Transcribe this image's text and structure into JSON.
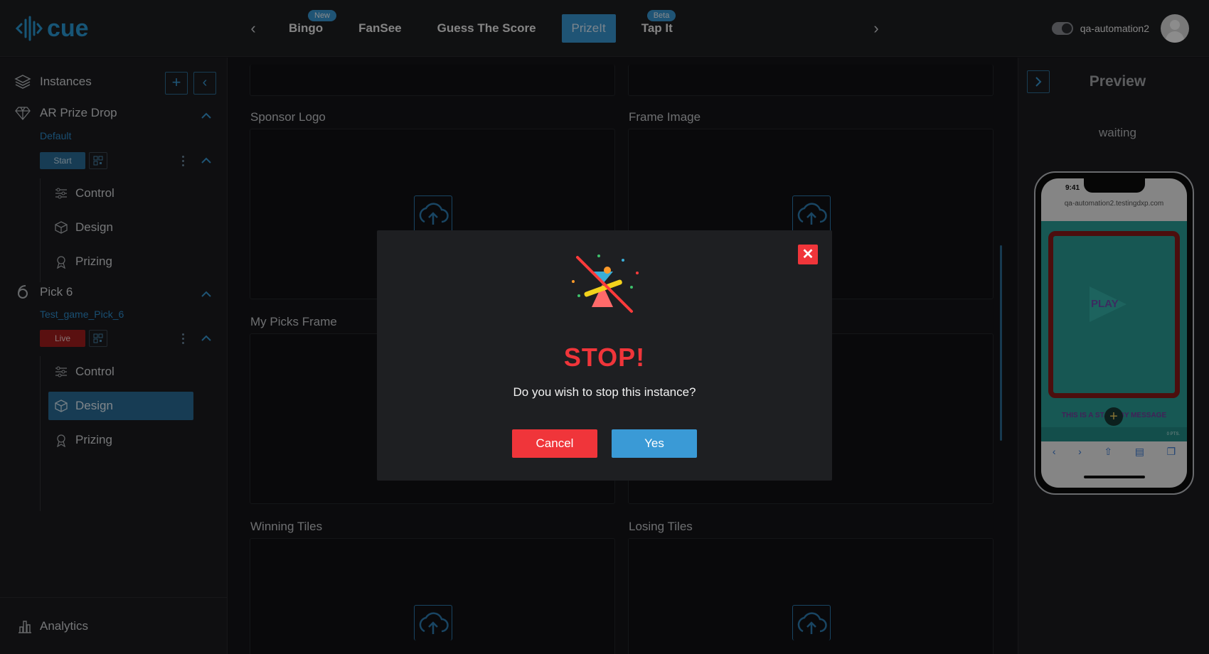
{
  "app": {
    "logo_text": "cue"
  },
  "topbar": {
    "tabs": [
      {
        "label": "Bingo",
        "badge": "New"
      },
      {
        "label": "FanSee",
        "badge": ""
      },
      {
        "label": "Guess The Score",
        "badge": ""
      },
      {
        "label": "PrizeIt",
        "badge": "",
        "active": true
      },
      {
        "label": "Tap It",
        "badge": "Beta"
      }
    ],
    "username": "qa-automation2"
  },
  "sidebar": {
    "header": "Instances",
    "instance1": {
      "name": "AR Prize Drop",
      "subtitle": "Default",
      "status": "Start",
      "menu": [
        "Control",
        "Design",
        "Prizing"
      ]
    },
    "instance2": {
      "name": "Pick 6",
      "subtitle": "Test_game_Pick_6",
      "status": "Live",
      "menu": [
        "Control",
        "Design",
        "Prizing"
      ],
      "active_item": "Design"
    },
    "analytics": "Analytics"
  },
  "main": {
    "fields": [
      "Sponsor Logo",
      "Frame Image",
      "My Picks Frame",
      "Winning Tiles",
      "Losing Tiles"
    ]
  },
  "preview": {
    "title": "Preview",
    "status": "waiting",
    "phone": {
      "time": "9:41",
      "url": "qa-automation2.testingdxp.com",
      "play": "PLAY",
      "standby": "THIS IS A STANDBY MESSAGE",
      "points": "0 PTS."
    }
  },
  "modal": {
    "title": "STOP!",
    "message": "Do you wish to stop this instance?",
    "cancel_label": "Cancel",
    "yes_label": "Yes"
  },
  "colors": {
    "accent": "#3a9ad6",
    "danger": "#f0353a",
    "background": "#141518"
  }
}
